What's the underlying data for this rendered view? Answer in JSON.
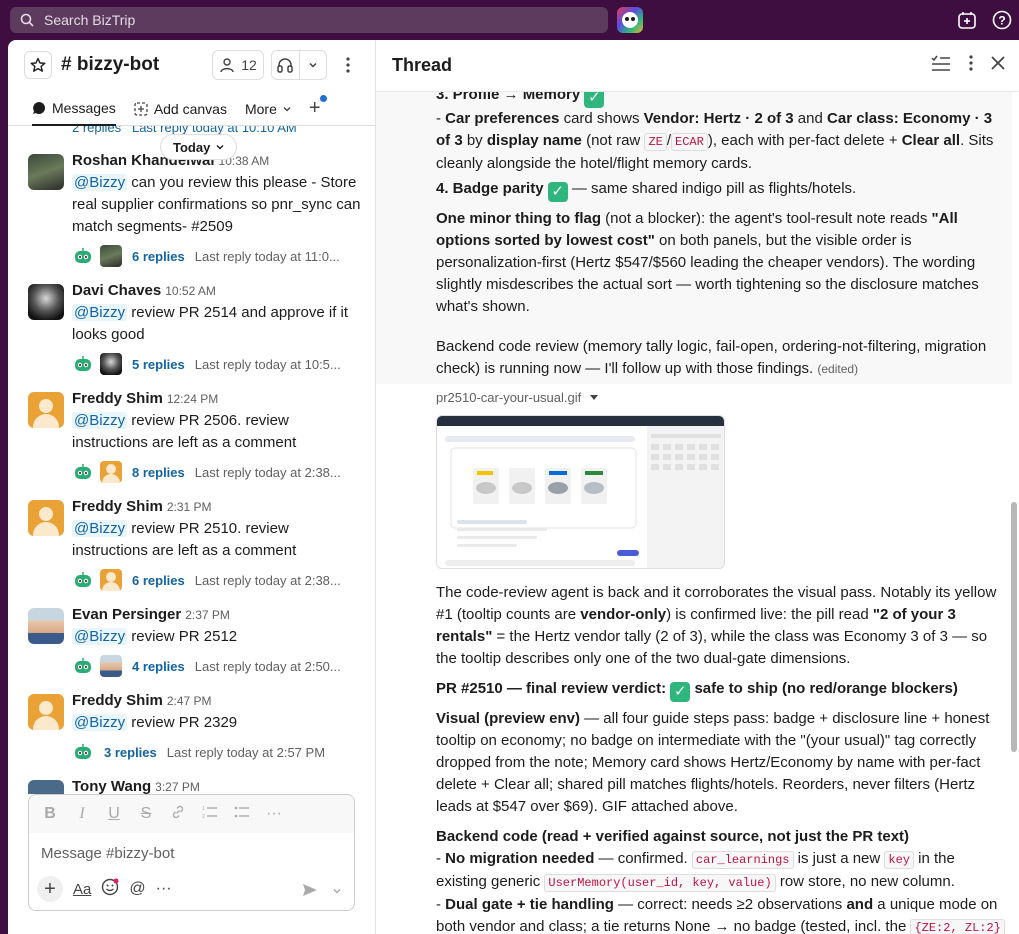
{
  "topbar": {
    "search_placeholder": "Search BizTrip"
  },
  "channel": {
    "name": "# bizzy-bot",
    "member_count": "12",
    "tabs": [
      "Messages",
      "Add canvas",
      "More"
    ],
    "today_label": "Today",
    "partial_line": "2 replies   Last reply today at 10:10 AM",
    "messages": [
      {
        "name": "Roshan Khandelwal",
        "time": "10:38 AM",
        "mention": "@Bizzy",
        "text": " can you review this please - Store real supplier confirmations so pnr_sync can match segments- #2509",
        "replies": "6 replies",
        "last": "Last reply today at 11:0..."
      },
      {
        "name": "Davi Chaves",
        "time": "10:52 AM",
        "mention": "@Bizzy",
        "text": " review PR 2514 and approve if it looks good",
        "replies": "5 replies",
        "last": "Last reply today at 10:5..."
      },
      {
        "name": "Freddy Shim",
        "time": "12:24 PM",
        "mention": "@Bizzy",
        "text": " review PR 2506. review instructions are left as a comment",
        "replies": "8 replies",
        "last": "Last reply today at 2:38..."
      },
      {
        "name": "Freddy Shim",
        "time": "2:31 PM",
        "mention": "@Bizzy",
        "text": " review PR 2510. review instructions are left as a comment",
        "replies": "6 replies",
        "last": "Last reply today at 2:38..."
      },
      {
        "name": "Evan Persinger",
        "time": "2:37 PM",
        "mention": "@Bizzy",
        "text": " review PR 2512",
        "replies": "4 replies",
        "last": "Last reply today at 2:50..."
      },
      {
        "name": "Freddy Shim",
        "time": "2:47 PM",
        "mention": "@Bizzy",
        "text": " review PR 2329",
        "replies": "3 replies",
        "last": "Last reply today at 2:57 PM"
      },
      {
        "name": "Tony Wang",
        "time": "3:27 PM"
      }
    ],
    "composer_placeholder": "Message #bizzy-bot"
  },
  "thread": {
    "title": "Thread",
    "p1_head": "3. Profile → Memory",
    "p1_a": "- ",
    "p1_b": "Car preferences",
    "p1_c": " card shows ",
    "p1_d": "Vendor: Hertz · 2 of 3",
    "p1_e": " and ",
    "p1_f": "Car class: Economy · 3 of 3",
    "p1_g": " by ",
    "p1_h": "display name",
    "p1_i": " (not raw ",
    "code_ze": "ZE",
    "p1_slash": "/",
    "code_ecar": "ECAR",
    "p1_j": "), each with per-fact delete + ",
    "p1_k": "Clear all",
    "p1_l": ". Sits cleanly alongside the hotel/flight memory cards.",
    "p2_head": "4. Badge parity",
    "p2_rest": " — same shared indigo pill as flights/hotels.",
    "p3_a": "One minor thing to flag",
    "p3_b": " (not a blocker): the agent's tool-result note reads ",
    "p3_c": "\"All options sorted by lowest cost\"",
    "p3_d": " on both panels, but the visible order is personalization-first (Hertz $547/$560 leading the cheaper vendors). The wording slightly misdescribes the actual sort — worth tightening so the disclosure matches what's shown.",
    "p4": "Backend code review (memory tally logic, fail-open, ordering-not-filtering, migration check) is running now — I'll follow up with those findings.",
    "edited": "(edited)",
    "gif_name": "pr2510-car-your-usual.gif",
    "p5_a": "The code-review agent is back and it corroborates the visual pass. Notably its yellow #1 (tooltip counts are ",
    "p5_b": "vendor-only",
    "p5_c": ") is confirmed live: the pill read ",
    "p5_d": "\"2 of your 3 rentals\"",
    "p5_e": " = the Hertz vendor tally (2 of 3), while the class was Economy 3 of 3 — so the tooltip describes only one of the two dual-gate dimensions.",
    "p6_a": "PR #2510 — final review verdict: ",
    "p6_b": " safe to ship (no red/orange blockers)",
    "p7_a": "Visual (preview env)",
    "p7_b": " — all four guide steps pass: badge + disclosure line + honest tooltip on economy; no badge on intermediate with the \"(your usual)\" tag correctly dropped from the note; Memory card shows Hertz/Economy by name with per-fact delete + Clear all; shared pill matches flights/hotels. Reorders, never filters (Hertz leads at $547 over $69). GIF attached above.",
    "p8_head": "Backend code (read + verified against source, not just the PR text)",
    "p8_a": "- ",
    "p8_b": "No migration needed",
    "p8_c": " — confirmed. ",
    "code_cl": "car_learnings",
    "p8_d": " is just a new ",
    "code_key": "key",
    "p8_e": " in the existing generic ",
    "code_um": "UserMemory(user_id, key, value)",
    "p8_f": " row store, no new column.",
    "p9_a": "- ",
    "p9_b": "Dual gate + tie handling",
    "p9_c": " — correct: needs ≥2 observations ",
    "p9_d": "and",
    "p9_e": " a unique mode on both vendor and class; a tie returns None → no badge (tested, incl. the ",
    "code_zl": "{ZE:2, ZL:2}"
  }
}
